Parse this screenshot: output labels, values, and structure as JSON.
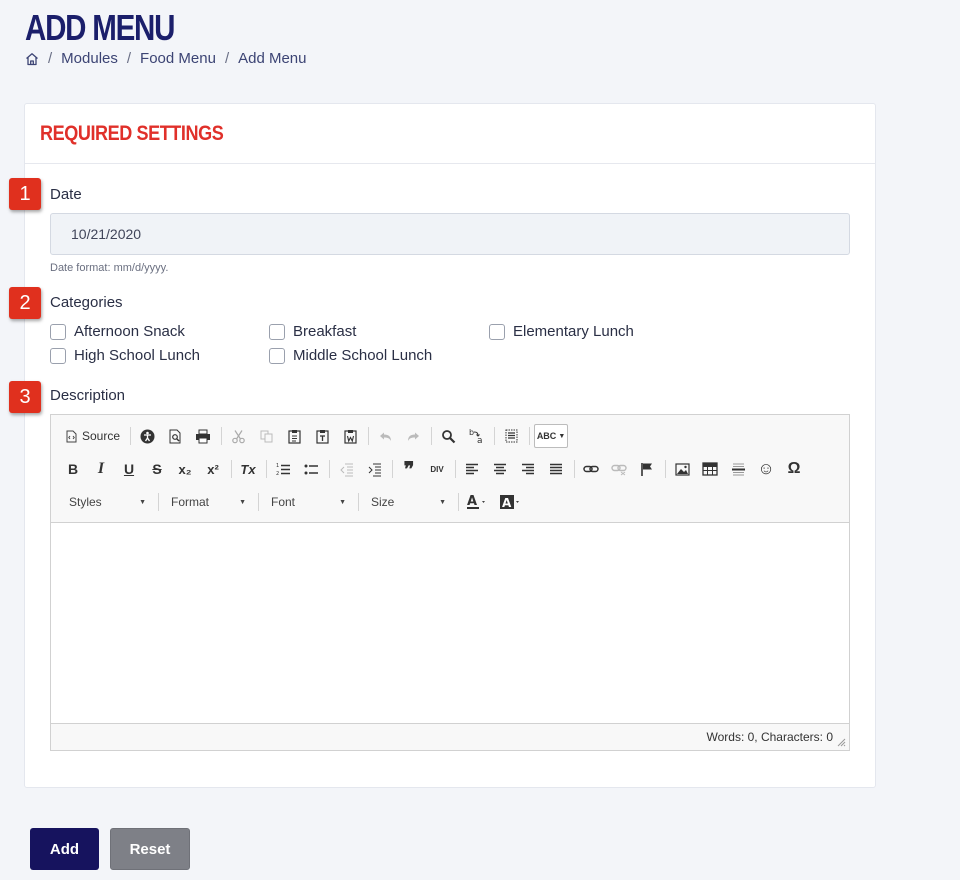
{
  "page": {
    "title": "ADD MENU"
  },
  "breadcrumb": {
    "home_icon": "home-icon",
    "separator": "/",
    "items": [
      "Modules",
      "Food Menu",
      "Add Menu"
    ]
  },
  "card": {
    "title": "REQUIRED SETTINGS"
  },
  "badges": [
    "1",
    "2",
    "3"
  ],
  "date": {
    "label": "Date",
    "value": "10/21/2020",
    "help": "Date format: mm/d/yyyy."
  },
  "categories": {
    "label": "Categories",
    "options": [
      {
        "label": "Afternoon Snack",
        "checked": false
      },
      {
        "label": "Breakfast",
        "checked": false
      },
      {
        "label": "Elementary Lunch",
        "checked": false
      },
      {
        "label": "High School Lunch",
        "checked": false
      },
      {
        "label": "Middle School Lunch",
        "checked": false
      }
    ]
  },
  "description": {
    "label": "Description",
    "toolbar": {
      "source_label": "Source",
      "spell_label": "ABC",
      "combos": [
        "Styles",
        "Format",
        "Font",
        "Size"
      ],
      "bold": "B",
      "italic": "I",
      "underline": "U",
      "strike": "S",
      "subscript": "x₂",
      "superscript": "x²",
      "clear_format": "Tx",
      "blockquote": "❞",
      "div": "DIV",
      "special_char": "Ω",
      "smiley": "☺"
    },
    "status": "Words: 0, Characters: 0"
  },
  "actions": {
    "add_label": "Add",
    "reset_label": "Reset"
  },
  "colors": {
    "title": "#1b1f6b",
    "section_title": "#e0302a",
    "badge": "#e0301e",
    "add_button": "#16135e",
    "reset_button": "#7e8087"
  }
}
